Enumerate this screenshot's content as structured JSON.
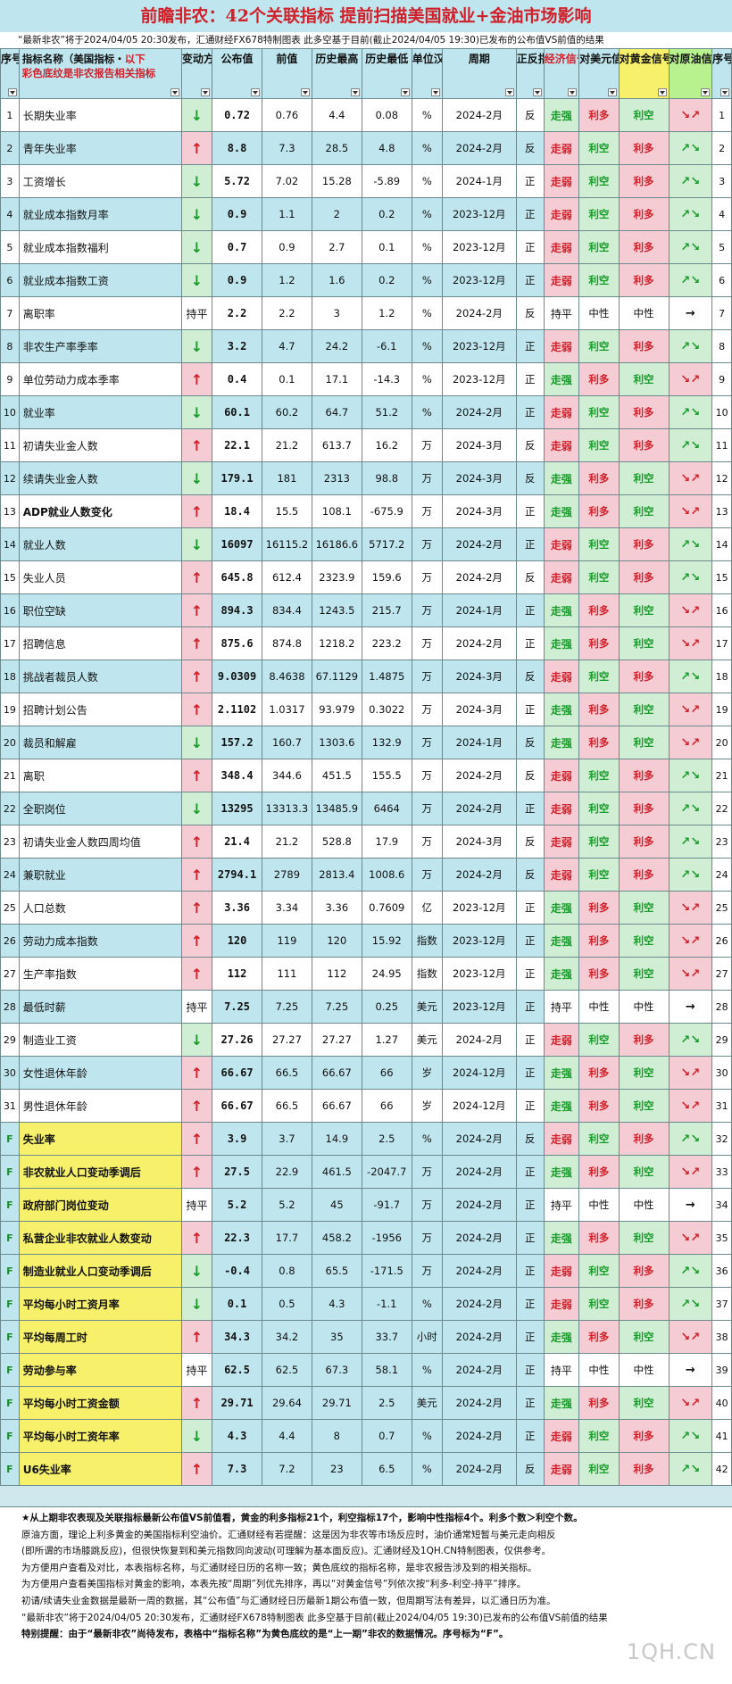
{
  "page": {
    "title": "前瞻非农：42个关联指标 提前扫描美国就业+金油市场影响",
    "subtitle": "“最新非农”将于2024/04/05 20:30发布，汇通财经FX678特制图表 此多空基于目前(截止2024/04/05 19:30)已发布的公布值VS前值的结果",
    "watermark": "1QH.CN"
  },
  "colors": {
    "header_bg": "#bfe6ee",
    "red_bull": "#d0202a",
    "green_bear": "#1a9a2a",
    "gold_header": "#f6f06a",
    "oil_header": "#b7f28f",
    "bull_cell": "#f5cbd4",
    "bear_cell": "#cfeed4"
  },
  "headers": {
    "no": "序号",
    "name_a": "指标名称（美国指标・",
    "name_b": "以下",
    "name_c": "彩色底纹是非农报告相关指标",
    "direction": "变动方向",
    "actual": "公布值",
    "previous": "前值",
    "hist_high": "历史最高",
    "hist_low": "历史最低",
    "unit": "单位汉化",
    "period": "周期",
    "sign": "正反指标",
    "econ": "经济信号",
    "usd": "对美元信号",
    "gold": "对黄金信号",
    "oil": "对原油信号",
    "no2": "序号"
  },
  "chart_data": {
    "type": "table",
    "columns": [
      "序号",
      "指标名称",
      "变动方向",
      "公布值",
      "前值",
      "历史最高",
      "历史最低",
      "单位汉化",
      "周期",
      "正反指标",
      "经济信号",
      "对美元信号",
      "对黄金信号",
      "对原油信号",
      "序号"
    ],
    "rows": [
      {
        "no": "1",
        "name": "长期失业率",
        "dir": "↓",
        "actual": "0.72",
        "prev": "0.76",
        "high": "4.4",
        "low": "0.08",
        "unit": "%",
        "period": "2024-2月",
        "sign": "反",
        "econ": "走强",
        "usd": "利多",
        "gold": "利空",
        "oil": "↘↗",
        "rno": "1"
      },
      {
        "no": "2",
        "name": "青年失业率",
        "dir": "↑",
        "actual": "8.8",
        "prev": "7.3",
        "high": "28.5",
        "low": "4.8",
        "unit": "%",
        "period": "2024-2月",
        "sign": "反",
        "econ": "走弱",
        "usd": "利空",
        "gold": "利多",
        "oil": "↗↘",
        "rno": "2"
      },
      {
        "no": "3",
        "name": "工资增长",
        "dir": "↓",
        "actual": "5.72",
        "prev": "7.02",
        "high": "15.28",
        "low": "-5.89",
        "unit": "%",
        "period": "2024-1月",
        "sign": "正",
        "econ": "走弱",
        "usd": "利空",
        "gold": "利多",
        "oil": "↗↘",
        "rno": "3"
      },
      {
        "no": "4",
        "name": "就业成本指数月率",
        "dir": "↓",
        "actual": "0.9",
        "prev": "1.1",
        "high": "2",
        "low": "0.2",
        "unit": "%",
        "period": "2023-12月",
        "sign": "正",
        "econ": "走弱",
        "usd": "利空",
        "gold": "利多",
        "oil": "↗↘",
        "rno": "4"
      },
      {
        "no": "5",
        "name": "就业成本指数福利",
        "dir": "↓",
        "actual": "0.7",
        "prev": "0.9",
        "high": "2.7",
        "low": "0.1",
        "unit": "%",
        "period": "2023-12月",
        "sign": "正",
        "econ": "走弱",
        "usd": "利空",
        "gold": "利多",
        "oil": "↗↘",
        "rno": "5"
      },
      {
        "no": "6",
        "name": "就业成本指数工资",
        "dir": "↓",
        "actual": "0.9",
        "prev": "1.2",
        "high": "1.6",
        "low": "0.2",
        "unit": "%",
        "period": "2023-12月",
        "sign": "正",
        "econ": "走弱",
        "usd": "利空",
        "gold": "利多",
        "oil": "↗↘",
        "rno": "6"
      },
      {
        "no": "7",
        "name": "离职率",
        "dir": "持平",
        "actual": "2.2",
        "prev": "2.2",
        "high": "3",
        "low": "1.2",
        "unit": "%",
        "period": "2024-2月",
        "sign": "反",
        "econ": "持平",
        "usd": "中性",
        "gold": "中性",
        "oil": "→",
        "rno": "7"
      },
      {
        "no": "8",
        "name": "非农生产率季率",
        "dir": "↓",
        "actual": "3.2",
        "prev": "4.7",
        "high": "24.2",
        "low": "-6.1",
        "unit": "%",
        "period": "2023-12月",
        "sign": "正",
        "econ": "走弱",
        "usd": "利空",
        "gold": "利多",
        "oil": "↗↘",
        "rno": "8"
      },
      {
        "no": "9",
        "name": "单位劳动力成本季率",
        "dir": "↑",
        "actual": "0.4",
        "prev": "0.1",
        "high": "17.1",
        "low": "-14.3",
        "unit": "%",
        "period": "2023-12月",
        "sign": "正",
        "econ": "走强",
        "usd": "利多",
        "gold": "利空",
        "oil": "↘↗",
        "rno": "9"
      },
      {
        "no": "10",
        "name": "就业率",
        "dir": "↓",
        "actual": "60.1",
        "prev": "60.2",
        "high": "64.7",
        "low": "51.2",
        "unit": "%",
        "period": "2024-2月",
        "sign": "正",
        "econ": "走弱",
        "usd": "利空",
        "gold": "利多",
        "oil": "↗↘",
        "rno": "10"
      },
      {
        "no": "11",
        "name": "初请失业金人数",
        "dir": "↑",
        "actual": "22.1",
        "prev": "21.2",
        "high": "613.7",
        "low": "16.2",
        "unit": "万",
        "period": "2024-3月",
        "sign": "反",
        "econ": "走弱",
        "usd": "利空",
        "gold": "利多",
        "oil": "↗↘",
        "rno": "11"
      },
      {
        "no": "12",
        "name": "续请失业金人数",
        "dir": "↓",
        "actual": "179.1",
        "prev": "181",
        "high": "2313",
        "low": "98.8",
        "unit": "万",
        "period": "2024-3月",
        "sign": "反",
        "econ": "走强",
        "usd": "利多",
        "gold": "利空",
        "oil": "↘↗",
        "rno": "12"
      },
      {
        "no": "13",
        "name": "ADP就业人数变化",
        "dir": "↑",
        "actual": "18.4",
        "prev": "15.5",
        "high": "108.1",
        "low": "-675.9",
        "unit": "万",
        "period": "2024-3月",
        "sign": "正",
        "econ": "走强",
        "usd": "利多",
        "gold": "利空",
        "oil": "↘↗",
        "rno": "13",
        "bold": true
      },
      {
        "no": "14",
        "name": "就业人数",
        "dir": "↓",
        "actual": "16097",
        "prev": "16115.2",
        "high": "16186.6",
        "low": "5717.2",
        "unit": "万",
        "period": "2024-2月",
        "sign": "正",
        "econ": "走弱",
        "usd": "利空",
        "gold": "利多",
        "oil": "↗↘",
        "rno": "14"
      },
      {
        "no": "15",
        "name": "失业人员",
        "dir": "↑",
        "actual": "645.8",
        "prev": "612.4",
        "high": "2323.9",
        "low": "159.6",
        "unit": "万",
        "period": "2024-2月",
        "sign": "反",
        "econ": "走弱",
        "usd": "利空",
        "gold": "利多",
        "oil": "↗↘",
        "rno": "15"
      },
      {
        "no": "16",
        "name": "职位空缺",
        "dir": "↑",
        "actual": "894.3",
        "prev": "834.4",
        "high": "1243.5",
        "low": "215.7",
        "unit": "万",
        "period": "2024-1月",
        "sign": "正",
        "econ": "走强",
        "usd": "利多",
        "gold": "利空",
        "oil": "↘↗",
        "rno": "16"
      },
      {
        "no": "17",
        "name": "招聘信息",
        "dir": "↑",
        "actual": "875.6",
        "prev": "874.8",
        "high": "1218.2",
        "low": "223.2",
        "unit": "万",
        "period": "2024-2月",
        "sign": "正",
        "econ": "走强",
        "usd": "利多",
        "gold": "利空",
        "oil": "↘↗",
        "rno": "17"
      },
      {
        "no": "18",
        "name": "挑战者裁员人数",
        "dir": "↑",
        "actual": "9.0309",
        "prev": "8.4638",
        "high": "67.1129",
        "low": "1.4875",
        "unit": "万",
        "period": "2024-3月",
        "sign": "反",
        "econ": "走弱",
        "usd": "利空",
        "gold": "利多",
        "oil": "↗↘",
        "rno": "18"
      },
      {
        "no": "19",
        "name": "招聘计划公告",
        "dir": "↑",
        "actual": "2.1102",
        "prev": "1.0317",
        "high": "93.979",
        "low": "0.3022",
        "unit": "万",
        "period": "2024-3月",
        "sign": "正",
        "econ": "走强",
        "usd": "利多",
        "gold": "利空",
        "oil": "↘↗",
        "rno": "19"
      },
      {
        "no": "20",
        "name": "裁员和解雇",
        "dir": "↓",
        "actual": "157.2",
        "prev": "160.7",
        "high": "1303.6",
        "low": "132.9",
        "unit": "万",
        "period": "2024-1月",
        "sign": "反",
        "econ": "走强",
        "usd": "利多",
        "gold": "利空",
        "oil": "↘↗",
        "rno": "20"
      },
      {
        "no": "21",
        "name": "离职",
        "dir": "↑",
        "actual": "348.4",
        "prev": "344.6",
        "high": "451.5",
        "low": "155.5",
        "unit": "万",
        "period": "2024-2月",
        "sign": "反",
        "econ": "走弱",
        "usd": "利空",
        "gold": "利多",
        "oil": "↗↘",
        "rno": "21"
      },
      {
        "no": "22",
        "name": "全职岗位",
        "dir": "↓",
        "actual": "13295",
        "prev": "13313.3",
        "high": "13485.9",
        "low": "6464",
        "unit": "万",
        "period": "2024-2月",
        "sign": "正",
        "econ": "走弱",
        "usd": "利空",
        "gold": "利多",
        "oil": "↗↘",
        "rno": "22"
      },
      {
        "no": "23",
        "name": "初请失业金人数四周均值",
        "dir": "↑",
        "actual": "21.4",
        "prev": "21.2",
        "high": "528.8",
        "low": "17.9",
        "unit": "万",
        "period": "2024-3月",
        "sign": "反",
        "econ": "走弱",
        "usd": "利空",
        "gold": "利多",
        "oil": "↗↘",
        "rno": "23"
      },
      {
        "no": "24",
        "name": "兼职就业",
        "dir": "↑",
        "actual": "2794.1",
        "prev": "2789",
        "high": "2813.4",
        "low": "1008.6",
        "unit": "万",
        "period": "2024-2月",
        "sign": "反",
        "econ": "走弱",
        "usd": "利空",
        "gold": "利多",
        "oil": "↗↘",
        "rno": "24"
      },
      {
        "no": "25",
        "name": "人口总数",
        "dir": "↑",
        "actual": "3.36",
        "prev": "3.34",
        "high": "3.36",
        "low": "0.7609",
        "unit": "亿",
        "period": "2023-12月",
        "sign": "正",
        "econ": "走强",
        "usd": "利多",
        "gold": "利空",
        "oil": "↘↗",
        "rno": "25"
      },
      {
        "no": "26",
        "name": "劳动力成本指数",
        "dir": "↑",
        "actual": "120",
        "prev": "119",
        "high": "120",
        "low": "15.92",
        "unit": "指数",
        "period": "2023-12月",
        "sign": "正",
        "econ": "走强",
        "usd": "利多",
        "gold": "利空",
        "oil": "↘↗",
        "rno": "26"
      },
      {
        "no": "27",
        "name": "生产率指数",
        "dir": "↑",
        "actual": "112",
        "prev": "111",
        "high": "112",
        "low": "24.95",
        "unit": "指数",
        "period": "2023-12月",
        "sign": "正",
        "econ": "走强",
        "usd": "利多",
        "gold": "利空",
        "oil": "↘↗",
        "rno": "27"
      },
      {
        "no": "28",
        "name": "最低时薪",
        "dir": "持平",
        "actual": "7.25",
        "prev": "7.25",
        "high": "7.25",
        "low": "0.25",
        "unit": "美元",
        "period": "2023-12月",
        "sign": "正",
        "econ": "持平",
        "usd": "中性",
        "gold": "中性",
        "oil": "→",
        "rno": "28"
      },
      {
        "no": "29",
        "name": "制造业工资",
        "dir": "↓",
        "actual": "27.26",
        "prev": "27.27",
        "high": "27.27",
        "low": "1.27",
        "unit": "美元",
        "period": "2024-2月",
        "sign": "正",
        "econ": "走弱",
        "usd": "利空",
        "gold": "利多",
        "oil": "↗↘",
        "rno": "29"
      },
      {
        "no": "30",
        "name": "女性退休年龄",
        "dir": "↑",
        "actual": "66.67",
        "prev": "66.5",
        "high": "66.67",
        "low": "66",
        "unit": "岁",
        "period": "2024-12月",
        "sign": "正",
        "econ": "走强",
        "usd": "利多",
        "gold": "利空",
        "oil": "↘↗",
        "rno": "30"
      },
      {
        "no": "31",
        "name": "男性退休年龄",
        "dir": "↑",
        "actual": "66.67",
        "prev": "66.5",
        "high": "66.67",
        "low": "66",
        "unit": "岁",
        "period": "2024-12月",
        "sign": "正",
        "econ": "走强",
        "usd": "利多",
        "gold": "利空",
        "oil": "↘↗",
        "rno": "31"
      },
      {
        "no": "F",
        "name": "失业率",
        "dir": "↑",
        "actual": "3.9",
        "prev": "3.7",
        "high": "14.9",
        "low": "2.5",
        "unit": "%",
        "period": "2024-2月",
        "sign": "反",
        "econ": "走弱",
        "usd": "利空",
        "gold": "利多",
        "oil": "↗↘",
        "rno": "32",
        "yellow": true,
        "bold": true
      },
      {
        "no": "F",
        "name": "非农就业人口变动季调后",
        "dir": "↑",
        "actual": "27.5",
        "prev": "22.9",
        "high": "461.5",
        "low": "-2047.7",
        "unit": "万",
        "period": "2024-2月",
        "sign": "正",
        "econ": "走强",
        "usd": "利多",
        "gold": "利空",
        "oil": "↘↗",
        "rno": "33",
        "yellow": true,
        "bold": true
      },
      {
        "no": "F",
        "name": "政府部门岗位变动",
        "dir": "持平",
        "actual": "5.2",
        "prev": "5.2",
        "high": "45",
        "low": "-91.7",
        "unit": "万",
        "period": "2024-2月",
        "sign": "正",
        "econ": "持平",
        "usd": "中性",
        "gold": "中性",
        "oil": "→",
        "rno": "34",
        "yellow": true
      },
      {
        "no": "F",
        "name": "私营企业非农就业人数变动",
        "dir": "↑",
        "actual": "22.3",
        "prev": "17.7",
        "high": "458.2",
        "low": "-1956",
        "unit": "万",
        "period": "2024-2月",
        "sign": "正",
        "econ": "走强",
        "usd": "利多",
        "gold": "利空",
        "oil": "↘↗",
        "rno": "35",
        "yellow": true
      },
      {
        "no": "F",
        "name": "制造业就业人口变动季调后",
        "dir": "↓",
        "actual": "-0.4",
        "prev": "0.8",
        "high": "65.5",
        "low": "-171.5",
        "unit": "万",
        "period": "2024-2月",
        "sign": "正",
        "econ": "走弱",
        "usd": "利空",
        "gold": "利多",
        "oil": "↗↘",
        "rno": "36",
        "yellow": true
      },
      {
        "no": "F",
        "name": "平均每小时工资月率",
        "dir": "↓",
        "actual": "0.1",
        "prev": "0.5",
        "high": "4.3",
        "low": "-1.1",
        "unit": "%",
        "period": "2024-2月",
        "sign": "正",
        "econ": "走弱",
        "usd": "利空",
        "gold": "利多",
        "oil": "↗↘",
        "rno": "37",
        "yellow": true
      },
      {
        "no": "F",
        "name": "平均每周工时",
        "dir": "↑",
        "actual": "34.3",
        "prev": "34.2",
        "high": "35",
        "low": "33.7",
        "unit": "小时",
        "period": "2024-2月",
        "sign": "正",
        "econ": "走强",
        "usd": "利多",
        "gold": "利空",
        "oil": "↘↗",
        "rno": "38",
        "yellow": true
      },
      {
        "no": "F",
        "name": "劳动参与率",
        "dir": "持平",
        "actual": "62.5",
        "prev": "62.5",
        "high": "67.3",
        "low": "58.1",
        "unit": "%",
        "period": "2024-2月",
        "sign": "正",
        "econ": "持平",
        "usd": "中性",
        "gold": "中性",
        "oil": "→",
        "rno": "39",
        "yellow": true
      },
      {
        "no": "F",
        "name": "平均每小时工资金额",
        "dir": "↑",
        "actual": "29.71",
        "prev": "29.64",
        "high": "29.71",
        "low": "2.5",
        "unit": "美元",
        "period": "2024-2月",
        "sign": "正",
        "econ": "走强",
        "usd": "利多",
        "gold": "利空",
        "oil": "↘↗",
        "rno": "40",
        "yellow": true
      },
      {
        "no": "F",
        "name": "平均每小时工资年率",
        "dir": "↓",
        "actual": "4.3",
        "prev": "4.4",
        "high": "8",
        "low": "0.7",
        "unit": "%",
        "period": "2024-2月",
        "sign": "正",
        "econ": "走弱",
        "usd": "利空",
        "gold": "利多",
        "oil": "↗↘",
        "rno": "41",
        "yellow": true
      },
      {
        "no": "F",
        "name": "U6失业率",
        "dir": "↑",
        "actual": "7.3",
        "prev": "7.2",
        "high": "23",
        "low": "6.5",
        "unit": "%",
        "period": "2024-2月",
        "sign": "反",
        "econ": "走弱",
        "usd": "利空",
        "gold": "利多",
        "oil": "↗↘",
        "rno": "42",
        "yellow": true
      }
    ]
  },
  "notes": [
    "★从上期非农表现及关联指标最新公布值VS前值看，黄金的利多指标21个，利空指标17个，影响中性指标4个。利多个数＞利空个数。",
    "原油方面，理论上利多黄金的美国指标利空油价。汇通财经有若提醒：这是因为非农等市场反应时，油价通常短暂与美元走向相反",
    "(即所谓的市场膝跳反应)，但很快恢复到和美元指数同向波动(可理解为基本面反应)。汇通财经及1QH.CN特制图表，仅供参考。",
    "为方便用户查看及对比，本表指标名称，与汇通财经日历的名称一致；黄色底纹的指标名称，是非农报告涉及到的相关指标。",
    "为方便用户查看美国指标对黄金的影响，本表先按“周期”列优先排序，再以“对黄金信号”列依次按“利多-利空-持平”排序。",
    "初请/续请失业金数据是最新一周的数据，其“公布值”与汇通财经日历最新1期公布值一致，但周期写法有差异，以汇通日历为准。",
    "“最新非农”将于2024/04/05 20:30发布，汇通财经FX678特制图表 此多空基于目前(截止2024/04/05 19:30)已发布的公布值VS前值的结果",
    "特别提醒：由于“最新非农”尚待发布，表格中“指标名称”为黄色底纹的是“上一期”非农的数据情况。序号标为“F”。"
  ]
}
